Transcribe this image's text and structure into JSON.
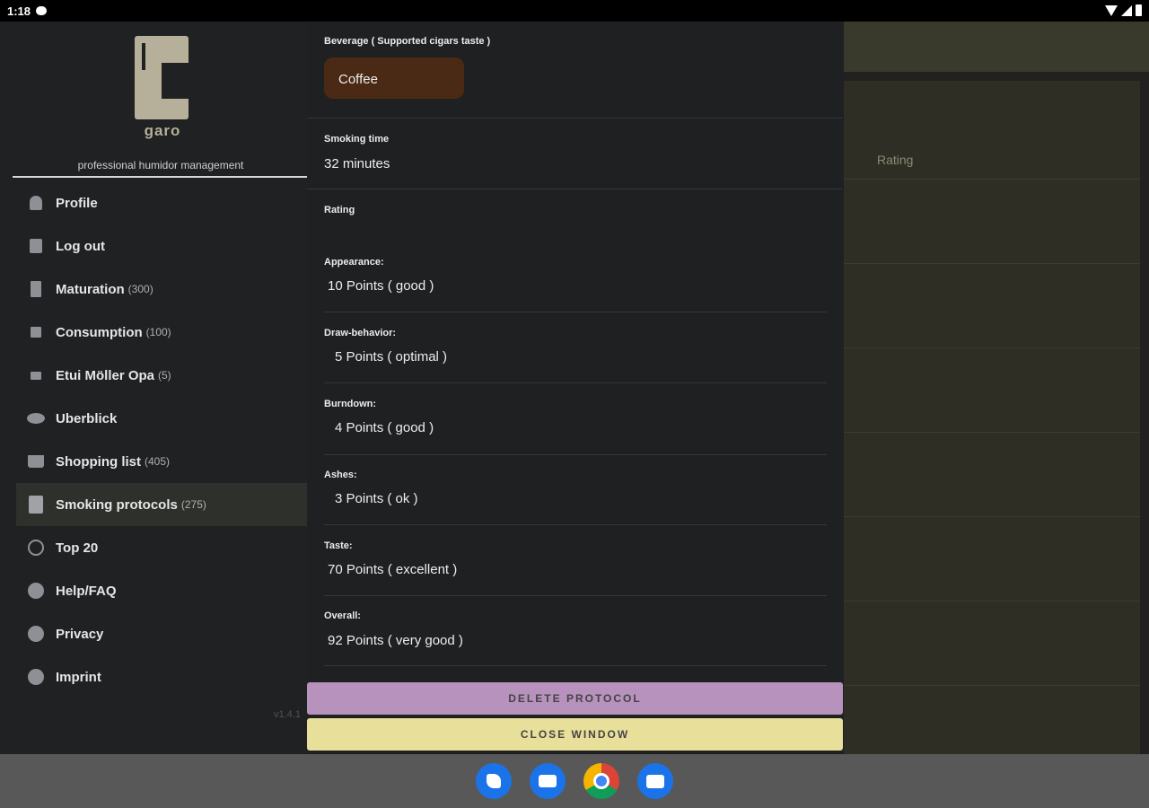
{
  "status_bar": {
    "time": "1:18"
  },
  "app": {
    "logo_text": "garo",
    "tagline": "professional humidor management",
    "version": "v1.4.1",
    "background_column_header": "Rating"
  },
  "nav": {
    "items": [
      {
        "label": "Profile",
        "count": "",
        "icon": "person-icon"
      },
      {
        "label": "Log out",
        "count": "",
        "icon": "logout-icon"
      },
      {
        "label": "Maturation",
        "count": "(300)",
        "icon": "cabinet-icon"
      },
      {
        "label": "Consumption",
        "count": "(100)",
        "icon": "cabinet-icon"
      },
      {
        "label": "Etui Möller Opa",
        "count": "(5)",
        "icon": "cabinet-icon"
      },
      {
        "label": "Uberblick",
        "count": "",
        "icon": "eye-icon"
      },
      {
        "label": "Shopping list",
        "count": "(405)",
        "icon": "cart-icon"
      },
      {
        "label": "Smoking protocols",
        "count": "(275)",
        "icon": "document-icon"
      },
      {
        "label": "Top 20",
        "count": "",
        "icon": "top-icon"
      },
      {
        "label": "Help/FAQ",
        "count": "",
        "icon": "help-icon"
      },
      {
        "label": "Privacy",
        "count": "",
        "icon": "info-icon"
      },
      {
        "label": "Imprint",
        "count": "",
        "icon": "info-icon"
      }
    ],
    "active_item": "Smoking protocols"
  },
  "dialog": {
    "beverage_label": "Beverage ( Supported cigars taste )",
    "beverage_value": "Coffee",
    "smoking_time_label": "Smoking time",
    "smoking_time_value": "32 minutes",
    "rating_label": "Rating",
    "ratings": [
      {
        "label": "Appearance:",
        "value": "10 Points ( good )"
      },
      {
        "label": "Draw-behavior:",
        "value": "5 Points ( optimal )"
      },
      {
        "label": "Burndown:",
        "value": "4 Points ( good )"
      },
      {
        "label": "Ashes:",
        "value": "3 Points ( ok )"
      },
      {
        "label": "Taste:",
        "value": "70 Points ( excellent )"
      },
      {
        "label": "Overall:",
        "value": "92 Points ( very good )"
      }
    ],
    "delete_button": "DELETE PROTOCOL",
    "close_button": "CLOSE WINDOW"
  },
  "colors": {
    "delete_button": "#b792bd",
    "close_button": "#e8df9a",
    "beverage_chip": "#4a2a14",
    "logo": "#b6b09a"
  }
}
